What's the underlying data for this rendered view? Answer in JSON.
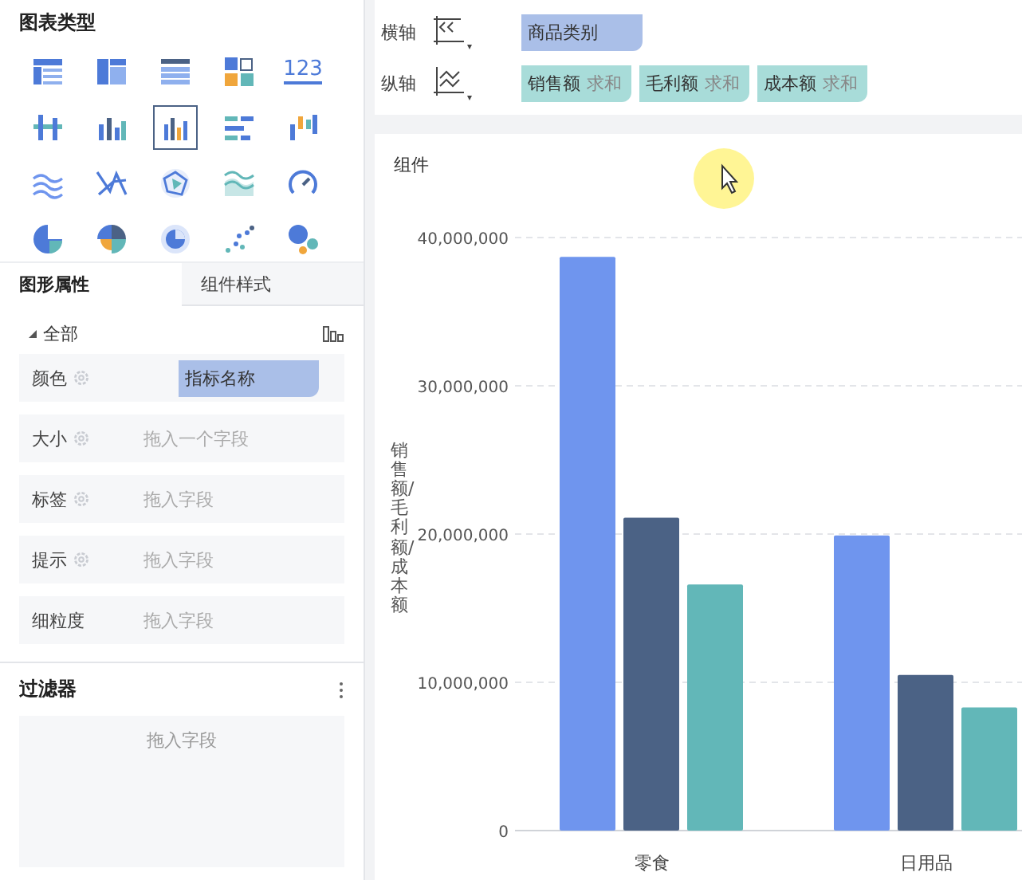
{
  "chart_types": {
    "title": "图表类型",
    "items": [
      {
        "kind": "table",
        "selected": false
      },
      {
        "kind": "crosstab",
        "selected": false
      },
      {
        "kind": "grid",
        "selected": false
      },
      {
        "kind": "blocks",
        "selected": false
      },
      {
        "kind": "number",
        "label": "123",
        "selected": false
      },
      {
        "kind": "dots",
        "selected": false
      },
      {
        "kind": "bars",
        "selected": false
      },
      {
        "kind": "groupbars",
        "selected": true
      },
      {
        "kind": "hbars",
        "selected": false
      },
      {
        "kind": "waterfall",
        "selected": false
      },
      {
        "kind": "waves",
        "selected": false
      },
      {
        "kind": "cross",
        "selected": false
      },
      {
        "kind": "radar",
        "selected": false
      },
      {
        "kind": "area",
        "selected": false
      },
      {
        "kind": "gauge",
        "selected": false
      },
      {
        "kind": "pie",
        "selected": false
      },
      {
        "kind": "rose",
        "selected": false
      },
      {
        "kind": "ring",
        "selected": false
      },
      {
        "kind": "scatter",
        "selected": false
      },
      {
        "kind": "bubble",
        "selected": false
      }
    ]
  },
  "tabs": [
    {
      "label": "图形属性",
      "selected": true
    },
    {
      "label": "组件样式",
      "selected": false
    }
  ],
  "properties": {
    "group": "全部",
    "expanded": true,
    "rows": [
      {
        "label": "颜色",
        "settings": true,
        "value": "指标名称"
      },
      {
        "label": "大小",
        "settings": true,
        "placeholder": "拖入一个字段"
      },
      {
        "label": "标签",
        "settings": true,
        "placeholder": "拖入字段"
      },
      {
        "label": "提示",
        "settings": true,
        "placeholder": "拖入字段"
      },
      {
        "label": "细粒度",
        "settings": false,
        "placeholder": "拖入字段"
      }
    ]
  },
  "filter": {
    "title": "过滤器",
    "placeholder": "拖入字段"
  },
  "axes": [
    {
      "label": "横轴",
      "kind": "x",
      "fields": [
        {
          "name": "商品类别",
          "kind": "dimension"
        }
      ]
    },
    {
      "label": "纵轴",
      "kind": "y",
      "fields": [
        {
          "name": "销售额",
          "agg": "求和",
          "kind": "measure"
        },
        {
          "name": "毛利额",
          "agg": "求和",
          "kind": "measure"
        },
        {
          "name": "成本额",
          "agg": "求和",
          "kind": "measure"
        }
      ]
    }
  ],
  "component": {
    "title": "组件",
    "chart_data": {
      "type": "bar",
      "ylabel": "销售额/毛利额/成本额",
      "categories": [
        "零食",
        "日用品"
      ],
      "ylim": [
        0,
        40000000
      ],
      "yticks": [
        {
          "value": 0,
          "label": "0"
        },
        {
          "value": 10000000,
          "label": "10,000,000"
        },
        {
          "value": 20000000,
          "label": "20,000,000"
        },
        {
          "value": 30000000,
          "label": "30,000,000"
        },
        {
          "value": 40000000,
          "label": "40,000,000"
        }
      ],
      "series": [
        {
          "color": "#6f95ee",
          "values": [
            38700000,
            19900000
          ]
        },
        {
          "color": "#4b6285",
          "values": [
            21100000,
            10500000
          ]
        },
        {
          "color": "#62b7b8",
          "values": [
            16600000,
            8300000
          ]
        }
      ],
      "grid": true
    }
  }
}
